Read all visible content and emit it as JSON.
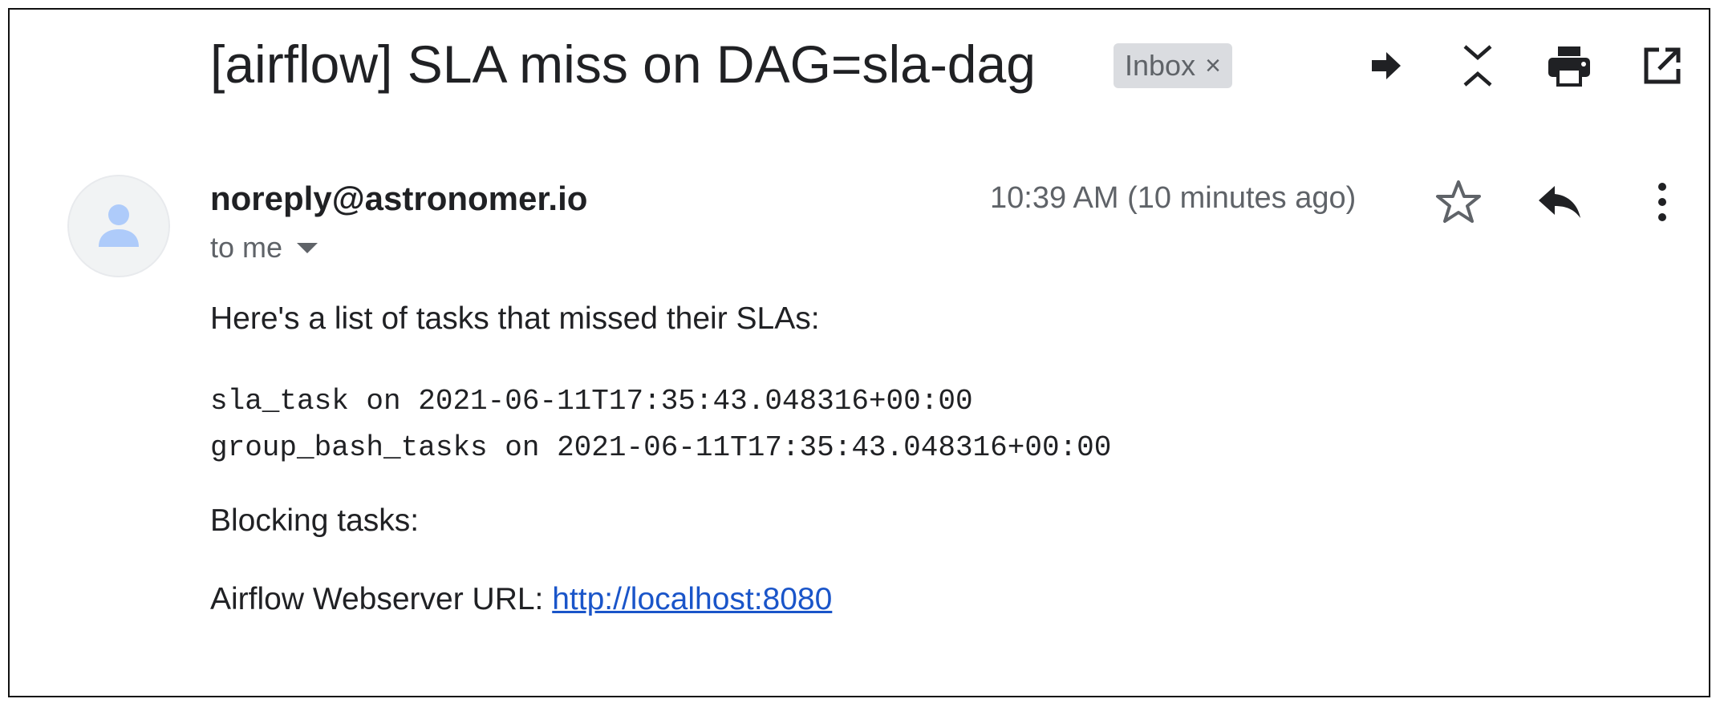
{
  "subject": "[airflow] SLA miss on DAG=sla-dag",
  "label": {
    "name": "Inbox",
    "remove": "×"
  },
  "sender": "noreply@astronomer.io",
  "recipient": "to me",
  "time": "10:39 AM (10 minutes ago)",
  "body": {
    "intro": "Here's a list of tasks that missed their SLAs:",
    "tasks": [
      "sla_task on 2021-06-11T17:35:43.048316+00:00",
      "group_bash_tasks on 2021-06-11T17:35:43.048316+00:00"
    ],
    "blocking": "Blocking tasks:",
    "url_label": "Airflow Webserver URL: ",
    "url": "http://localhost:8080"
  },
  "icons": {
    "toolbar": [
      "forward-arrow-icon",
      "collapse-all-icon",
      "print-icon",
      "open-in-new-window-icon"
    ],
    "message": [
      "star-icon",
      "reply-icon",
      "more-vert-icon"
    ],
    "avatar": "person-icon"
  },
  "colors": {
    "link": "#1a55c9",
    "chip": "#dadce0",
    "icon": "#5f6368",
    "avatar": "#aecbfa"
  }
}
